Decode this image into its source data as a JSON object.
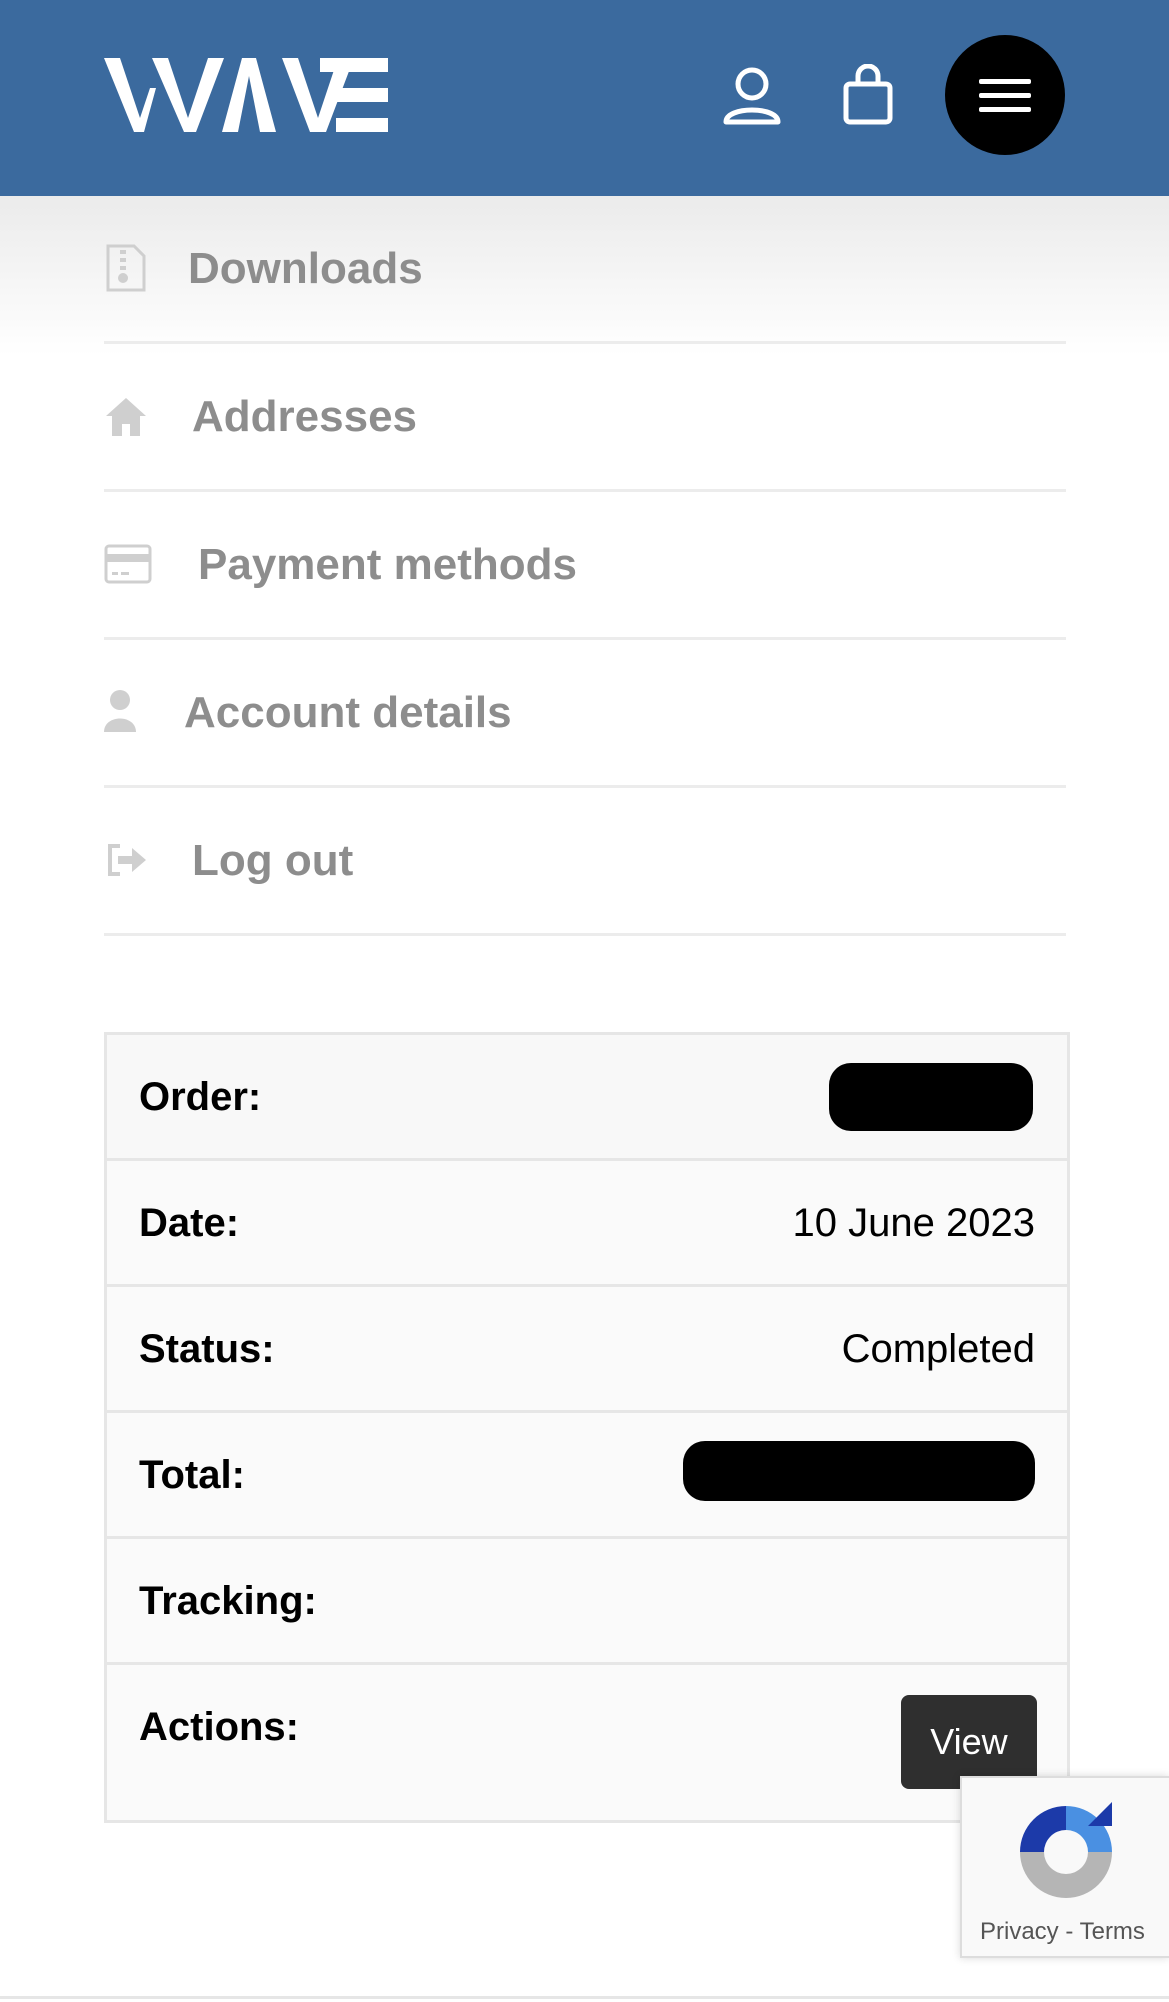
{
  "header": {
    "logo_text": "WAVE",
    "icons": [
      "account-icon",
      "shopping-bag-icon",
      "hamburger-menu-icon"
    ],
    "background": "#3b6a9e"
  },
  "nav": {
    "items": [
      {
        "label": "Downloads",
        "icon": "zip-file-icon"
      },
      {
        "label": "Addresses",
        "icon": "home-icon"
      },
      {
        "label": "Payment methods",
        "icon": "credit-card-icon"
      },
      {
        "label": "Account details",
        "icon": "user-icon"
      },
      {
        "label": "Log out",
        "icon": "sign-out-icon"
      }
    ]
  },
  "order": {
    "rows": [
      {
        "label": "Order:",
        "value": ""
      },
      {
        "label": "Date:",
        "value": "10 June 2023"
      },
      {
        "label": "Status:",
        "value": "Completed"
      },
      {
        "label": "Total:",
        "value": ""
      },
      {
        "label": "Tracking:",
        "value": ""
      },
      {
        "label": "Actions:",
        "value": ""
      }
    ],
    "view_button": "View"
  },
  "recaptcha": {
    "privacy": "Privacy",
    "separator": " - ",
    "terms": "Terms"
  }
}
